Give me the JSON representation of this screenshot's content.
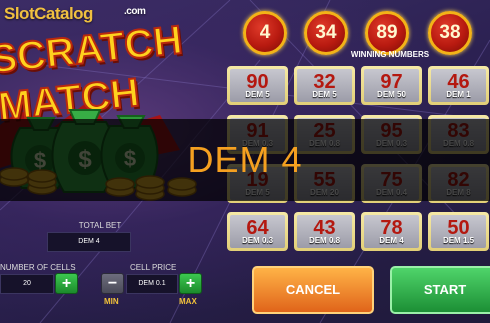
{
  "watermark": {
    "text": "SlotCatalog",
    "suffix": ".com"
  },
  "logo": {
    "line1": "SCRATCH",
    "line2": "MATCH"
  },
  "controls": {
    "total_bet_label": "TOTAL BET",
    "total_bet_value": "DEM 4",
    "cells_label": "NUMBER OF CELLS",
    "cells_value": "20",
    "cell_price_label": "CELL PRICE",
    "cell_price_value": "DEM 0.1",
    "minus_symbol": "−",
    "plus_symbol": "+",
    "min_label": "MIN",
    "max_label": "MAX"
  },
  "winning": {
    "label": "WINNING NUMBERS",
    "numbers": [
      "4",
      "34",
      "89",
      "38"
    ]
  },
  "grid": [
    [
      {
        "num": "90",
        "prize": "DEM 5"
      },
      {
        "num": "32",
        "prize": "DEM 5"
      },
      {
        "num": "97",
        "prize": "DEM 50"
      },
      {
        "num": "46",
        "prize": "DEM 1"
      }
    ],
    [
      {
        "num": "91",
        "prize": "DEM 0.3"
      },
      {
        "num": "25",
        "prize": "DEM 0.8"
      },
      {
        "num": "95",
        "prize": "DEM 0.3"
      },
      {
        "num": "83",
        "prize": "DEM 0.8"
      }
    ],
    [
      {
        "num": "19",
        "prize": "DEM 5"
      },
      {
        "num": "55",
        "prize": "DEM 20"
      },
      {
        "num": "75",
        "prize": "DEM 0.4"
      },
      {
        "num": "82",
        "prize": "DEM 8"
      }
    ],
    [
      {
        "num": "64",
        "prize": "DEM 0.3"
      },
      {
        "num": "43",
        "prize": "DEM 0.8"
      },
      {
        "num": "78",
        "prize": "DEM 4"
      },
      {
        "num": "50",
        "prize": "DEM 1.5"
      }
    ]
  ],
  "overlay": {
    "text": "DEM 4"
  },
  "buttons": {
    "cancel": "CANCEL",
    "start": "START"
  },
  "colors": {
    "accent": "#f5a020",
    "cell_number": "#b41810",
    "win_ball": "#b81a10"
  }
}
